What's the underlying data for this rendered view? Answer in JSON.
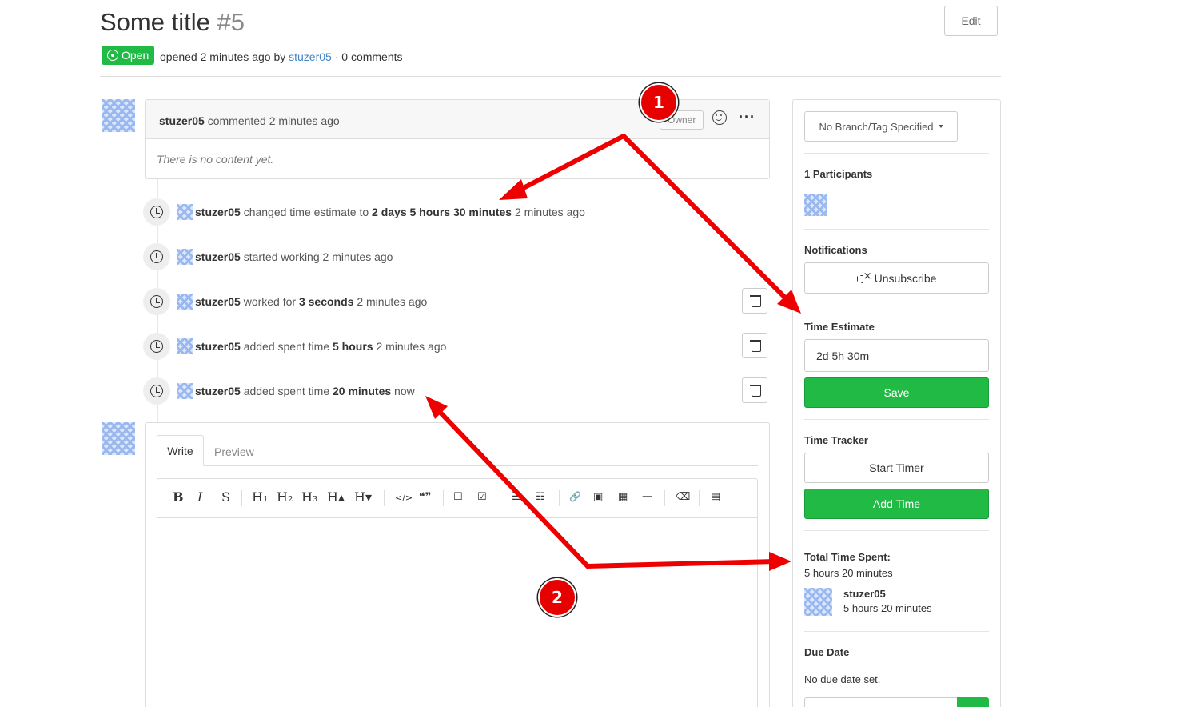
{
  "issue": {
    "title": "Some title",
    "number": "#5",
    "edit_label": "Edit",
    "state_label": "Open",
    "meta_prefix": "opened 2 minutes ago by",
    "author": "stuzer05",
    "meta_suffix": "· 0 comments"
  },
  "comment": {
    "author": "stuzer05",
    "action": "commented 2 minutes ago",
    "role_label": "Owner",
    "more_label": "···",
    "body": "There is no content yet."
  },
  "timeline": [
    {
      "user": "stuzer05",
      "pre": "changed time estimate to",
      "bold": "2 days 5 hours 30 minutes",
      "post": "2 minutes ago"
    },
    {
      "user": "stuzer05",
      "pre": "started working 2 minutes ago",
      "bold": "",
      "post": ""
    },
    {
      "user": "stuzer05",
      "pre": "worked for",
      "bold": "3 seconds",
      "post": "2 minutes ago"
    },
    {
      "user": "stuzer05",
      "pre": "added spent time",
      "bold": "5 hours",
      "post": "2 minutes ago"
    },
    {
      "user": "stuzer05",
      "pre": "added spent time",
      "bold": "20 minutes",
      "post": "now"
    }
  ],
  "editor": {
    "tab_write": "Write",
    "tab_preview": "Preview",
    "toolbar": {
      "bold": "B",
      "italic": "I",
      "strike": "S",
      "h1": "H₁",
      "h2": "H₂",
      "h3": "H₃",
      "h_up": "H▴",
      "h_down": "H▾",
      "code": "</>",
      "quote": "❝❞",
      "checkbox": "☐",
      "checked": "☑",
      "ul": "☰",
      "ol": "☷",
      "link": "🔗",
      "image": "▣",
      "table": "▦",
      "hr": "—",
      "erase": "⌫",
      "file": "▤"
    }
  },
  "sidebar": {
    "branch_label": "No Branch/Tag Specified",
    "participants_label": "1 Participants",
    "notifications_label": "Notifications",
    "unsubscribe_label": "Unsubscribe",
    "time_estimate_label": "Time Estimate",
    "time_estimate_value": "2d 5h 30m",
    "save_label": "Save",
    "time_tracker_label": "Time Tracker",
    "start_timer_label": "Start Timer",
    "add_time_label": "Add Time",
    "total_time_label": "Total Time Spent:",
    "total_time_value": "5 hours 20 minutes",
    "user_name": "stuzer05",
    "user_time": "5 hours 20 minutes",
    "due_date_label": "Due Date",
    "due_date_value": "No due date set."
  },
  "annotations": {
    "badge1": "1",
    "badge2": "2",
    "arrow_color": "#ee0000"
  },
  "colors": {
    "green": "#21ba45",
    "link": "#4183c4"
  }
}
